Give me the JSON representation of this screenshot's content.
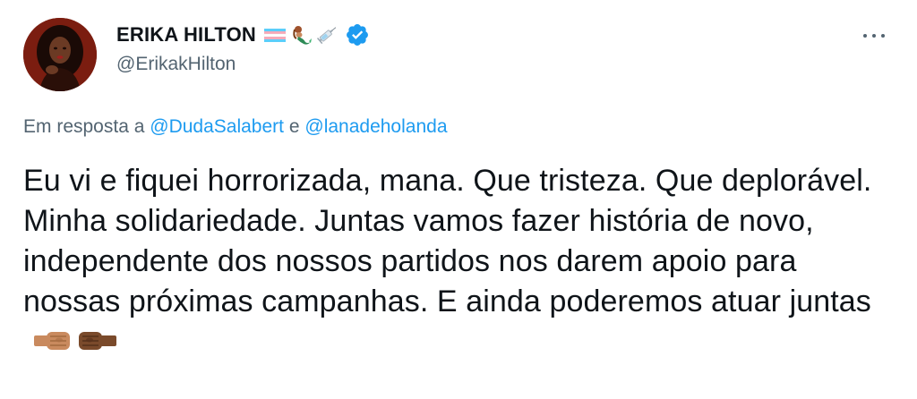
{
  "author": {
    "name": "ERIKA HILTON",
    "handle": "@ErikakHilton",
    "name_emojis": [
      "transgender-flag-emoji",
      "mermaid-emoji",
      "syringe-emoji"
    ],
    "verified": true
  },
  "reply": {
    "prefix": "Em resposta a",
    "mention_1": "@DudaSalabert",
    "conjunction": "e",
    "mention_2": "@lanadeholanda"
  },
  "tweet": {
    "text": "Eu vi e fiquei horrorizada, mana. Que tristeza. Que deplorável. Minha solidariedade. Juntas vamos fazer história de novo, independente dos nossos partidos nos darem apoio para nossas próximas campanhas. E ainda poderemos atuar juntas",
    "trailing_emojis": [
      "fist-bump-left-emoji",
      "fist-bump-right-emoji"
    ]
  },
  "colors": {
    "text": "#0f1419",
    "secondary": "#536471",
    "link": "#1d9bf0"
  }
}
